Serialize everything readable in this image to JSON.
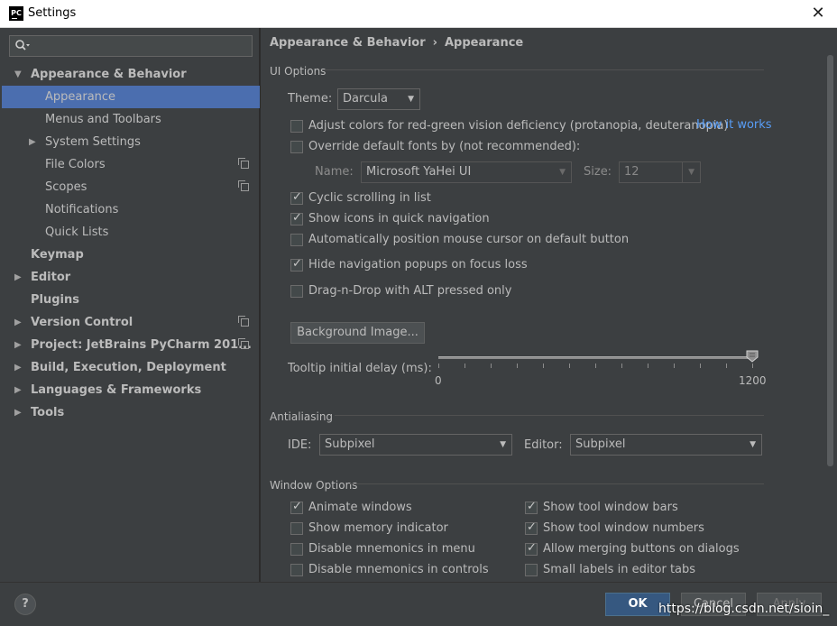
{
  "window": {
    "title": "Settings",
    "app_icon_text": "PC"
  },
  "search": {
    "placeholder": ""
  },
  "sidebar": {
    "items": [
      {
        "label": "Appearance & Behavior",
        "level": 0,
        "arrow": "▼",
        "bold": true
      },
      {
        "label": "Appearance",
        "level": 1,
        "selected": true
      },
      {
        "label": "Menus and Toolbars",
        "level": 1
      },
      {
        "label": "System Settings",
        "level": 1,
        "arrow": "▶"
      },
      {
        "label": "File Colors",
        "level": 1,
        "copy": true
      },
      {
        "label": "Scopes",
        "level": 1,
        "copy": true
      },
      {
        "label": "Notifications",
        "level": 1
      },
      {
        "label": "Quick Lists",
        "level": 1
      },
      {
        "label": "Keymap",
        "level": 0,
        "bold": true
      },
      {
        "label": "Editor",
        "level": 0,
        "arrow": "▶",
        "bold": true
      },
      {
        "label": "Plugins",
        "level": 0,
        "bold": true
      },
      {
        "label": "Version Control",
        "level": 0,
        "arrow": "▶",
        "bold": true,
        "copy": true
      },
      {
        "label": "Project: JetBrains PyCharm 201...",
        "level": 0,
        "arrow": "▶",
        "bold": true,
        "copy": true
      },
      {
        "label": "Build, Execution, Deployment",
        "level": 0,
        "arrow": "▶",
        "bold": true
      },
      {
        "label": "Languages & Frameworks",
        "level": 0,
        "arrow": "▶",
        "bold": true
      },
      {
        "label": "Tools",
        "level": 0,
        "arrow": "▶",
        "bold": true
      }
    ]
  },
  "breadcrumb": {
    "parent": "Appearance & Behavior",
    "separator": "›",
    "current": "Appearance"
  },
  "ui_options": {
    "title": "UI Options",
    "theme_label": "Theme:",
    "theme_value": "Darcula",
    "adjust_colors": {
      "label": "Adjust colors for red-green vision deficiency (protanopia, deuteranopia)",
      "checked": false
    },
    "how_it_works": "How it works",
    "override_fonts": {
      "label": "Override default fonts by (not recommended):",
      "checked": false
    },
    "font_name_label": "Name:",
    "font_name_value": "Microsoft YaHei UI",
    "font_size_label": "Size:",
    "font_size_value": "12",
    "cyclic_scrolling": {
      "label": "Cyclic scrolling in list",
      "checked": true
    },
    "show_icons": {
      "label": "Show icons in quick navigation",
      "checked": true
    },
    "auto_position": {
      "label": "Automatically position mouse cursor on default button",
      "checked": false
    },
    "hide_popups": {
      "label": "Hide navigation popups on focus loss",
      "checked": true
    },
    "drag_drop": {
      "label": "Drag-n-Drop with ALT pressed only",
      "checked": false
    },
    "background_image_button": "Background Image...",
    "tooltip_label": "Tooltip initial delay (ms):",
    "tooltip_min": "0",
    "tooltip_max": "1200",
    "tooltip_value": 1200
  },
  "antialiasing": {
    "title": "Antialiasing",
    "ide_label": "IDE:",
    "ide_value": "Subpixel",
    "editor_label": "Editor:",
    "editor_value": "Subpixel"
  },
  "window_options": {
    "title": "Window Options",
    "left": [
      {
        "label": "Animate windows",
        "checked": true
      },
      {
        "label": "Show memory indicator",
        "checked": false
      },
      {
        "label": "Disable mnemonics in menu",
        "checked": false
      },
      {
        "label": "Disable mnemonics in controls",
        "checked": false
      }
    ],
    "right": [
      {
        "label": "Show tool window bars",
        "checked": true
      },
      {
        "label": "Show tool window numbers",
        "checked": true
      },
      {
        "label": "Allow merging buttons on dialogs",
        "checked": true
      },
      {
        "label": "Small labels in editor tabs",
        "checked": false
      }
    ]
  },
  "footer": {
    "help": "?",
    "ok": "OK",
    "cancel": "Cancel",
    "apply": "Apply",
    "watermark": "https://blog.csdn.net/sioin_"
  },
  "colors": {
    "background": "#3c3f41",
    "selection": "#4b6eaf",
    "link": "#589df6",
    "primary_button": "#365880"
  }
}
